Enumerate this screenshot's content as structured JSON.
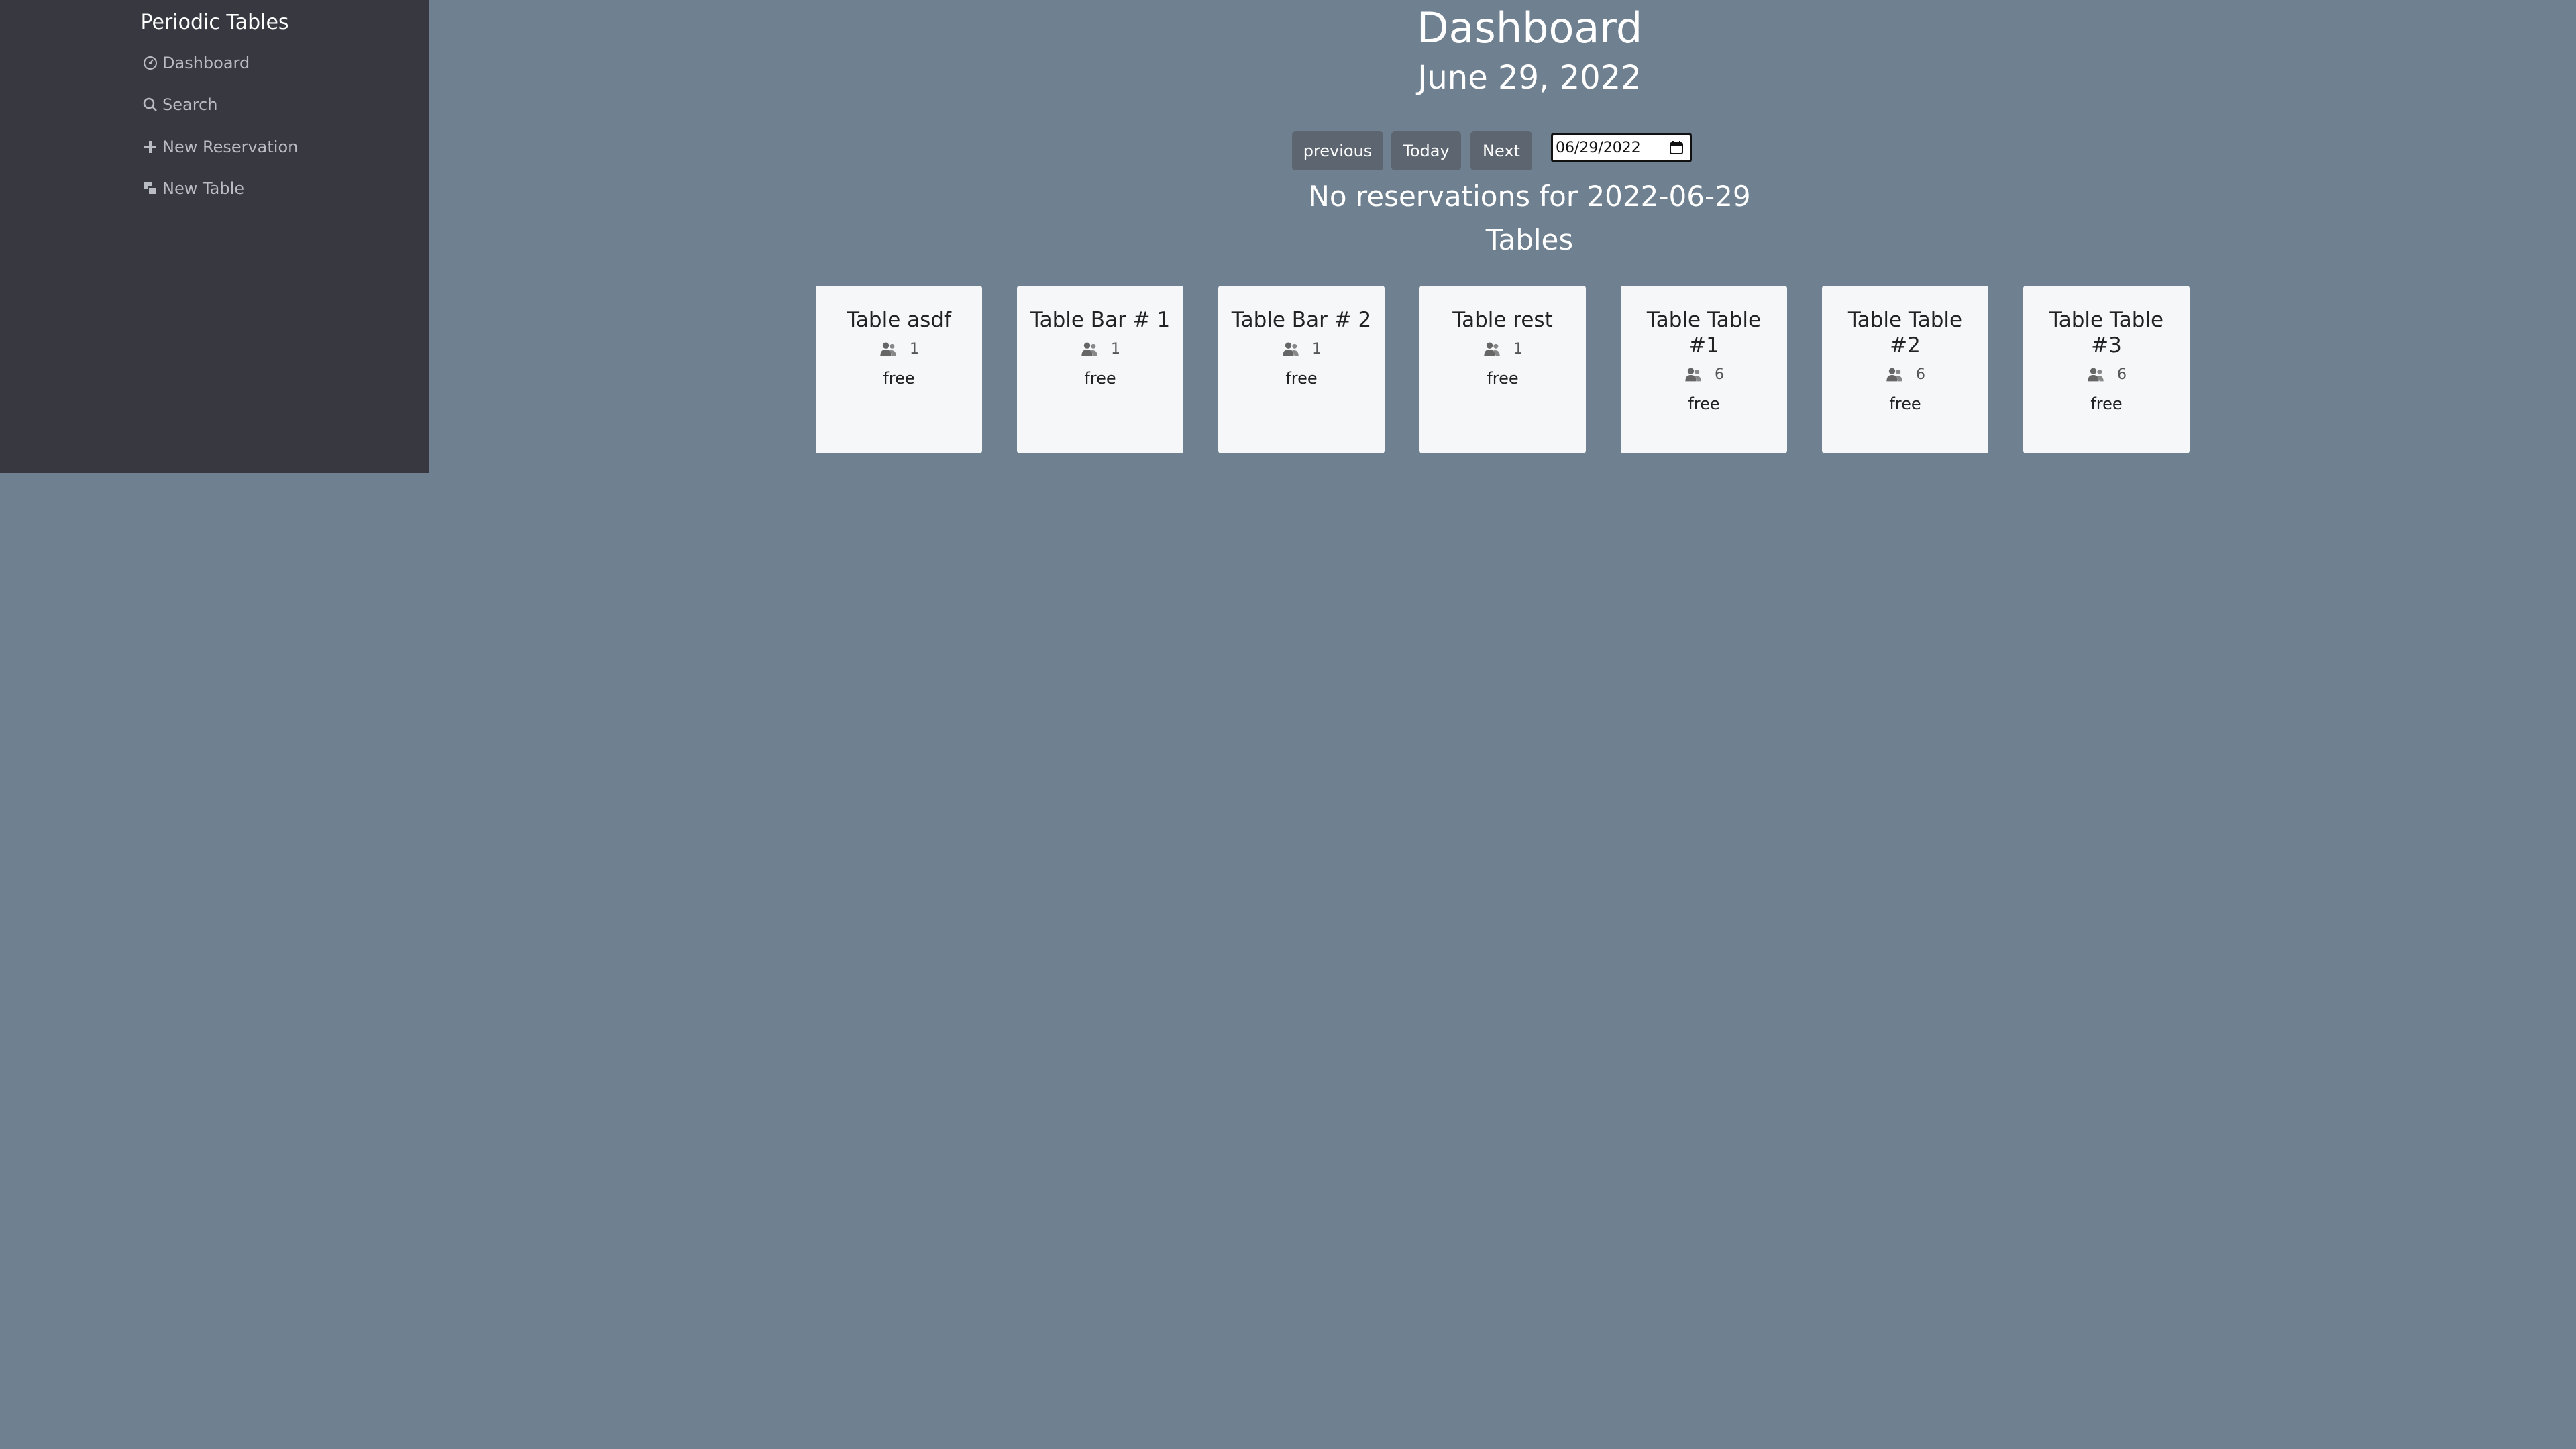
{
  "sidebar": {
    "brand": "Periodic Tables",
    "items": [
      {
        "label": "Dashboard",
        "icon": "dashboard-icon"
      },
      {
        "label": "Search",
        "icon": "search-icon"
      },
      {
        "label": "New Reservation",
        "icon": "plus-icon"
      },
      {
        "label": "New Table",
        "icon": "table-icon"
      }
    ]
  },
  "main": {
    "title": "Dashboard",
    "date_heading": "June 29, 2022",
    "buttons": {
      "previous": "previous",
      "today": "Today",
      "next": "Next"
    },
    "date_input_value": "06/29/2022",
    "no_reservations": "No reservations for 2022-06-29",
    "tables_heading": "Tables",
    "tables": [
      {
        "name": "Table asdf",
        "capacity": "1",
        "status": "free"
      },
      {
        "name": "Table Bar # 1",
        "capacity": "1",
        "status": "free"
      },
      {
        "name": "Table Bar # 2",
        "capacity": "1",
        "status": "free"
      },
      {
        "name": "Table rest",
        "capacity": "1",
        "status": "free"
      },
      {
        "name": "Table Table #1",
        "capacity": "6",
        "status": "free"
      },
      {
        "name": "Table Table #2",
        "capacity": "6",
        "status": "free"
      },
      {
        "name": "Table Table #3",
        "capacity": "6",
        "status": "free"
      }
    ]
  }
}
